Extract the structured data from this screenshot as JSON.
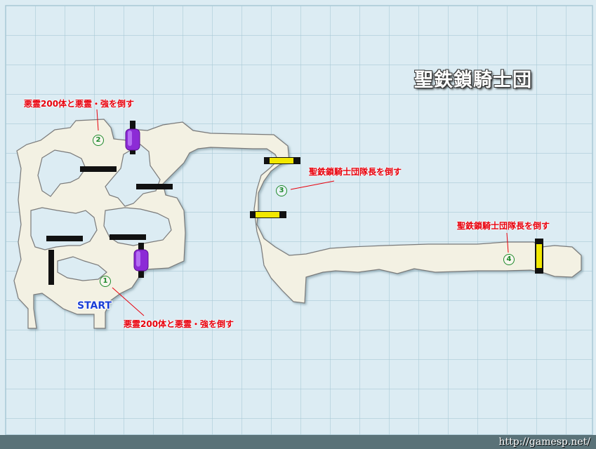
{
  "map": {
    "title": "聖鉄鎖騎士団",
    "start_label": "START",
    "footer_url": "http://gamesp.net/",
    "markers": [
      {
        "num": "1",
        "label": "悪霊200体と悪霊・強を倒す"
      },
      {
        "num": "2",
        "label": "悪霊200体と悪霊・強を倒す"
      },
      {
        "num": "3",
        "label": "聖鉄鎖騎士団隊長を倒す"
      },
      {
        "num": "4",
        "label": "聖鉄鎖騎士団隊長を倒す"
      }
    ],
    "colors": {
      "floor": "#f3f1e3",
      "wall_line": "#7a7a7a",
      "grid": "#a9c9d6",
      "background": "#dcecf3",
      "purple_gate": "#8c2bd6",
      "yellow_gate": "#f2e800",
      "label_red": "#e8000c",
      "marker_green": "#1e8a2b"
    }
  }
}
